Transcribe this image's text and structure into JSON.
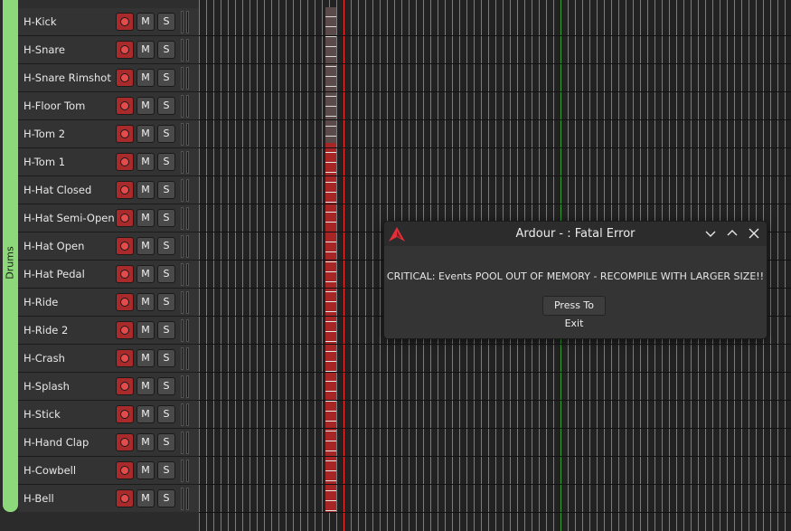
{
  "group": {
    "label": "Drums",
    "color": "#8dd87a"
  },
  "track_buttons": {
    "record_icon": "record-dot-icon",
    "mute_label": "M",
    "solo_label": "S"
  },
  "tracks": [
    {
      "name": "H-Kick"
    },
    {
      "name": "H-Snare"
    },
    {
      "name": "H-Snare Rimshot"
    },
    {
      "name": "H-Floor Tom"
    },
    {
      "name": "H-Tom 2"
    },
    {
      "name": "H-Tom 1"
    },
    {
      "name": "H-Hat Closed"
    },
    {
      "name": "H-Hat Semi-Open"
    },
    {
      "name": "H-Hat Open"
    },
    {
      "name": "H-Hat Pedal"
    },
    {
      "name": "H-Ride"
    },
    {
      "name": "H-Ride 2"
    },
    {
      "name": "H-Crash"
    },
    {
      "name": "H-Splash"
    },
    {
      "name": "H-Stick"
    },
    {
      "name": "H-Hand Clap"
    },
    {
      "name": "H-Cowbell"
    },
    {
      "name": "H-Bell"
    }
  ],
  "colors": {
    "region": "#a82525",
    "playhead": "#ff3030",
    "marker": "#3aa03a"
  },
  "dialog": {
    "title": "Ardour - : Fatal Error",
    "message": "CRITICAL: Events POOL OUT OF MEMORY - RECOMPILE WITH LARGER SIZE!!",
    "exit_label": "Press To Exit",
    "icons": [
      "ardour-logo-icon",
      "minimize-icon",
      "maximize-icon",
      "close-icon"
    ]
  }
}
